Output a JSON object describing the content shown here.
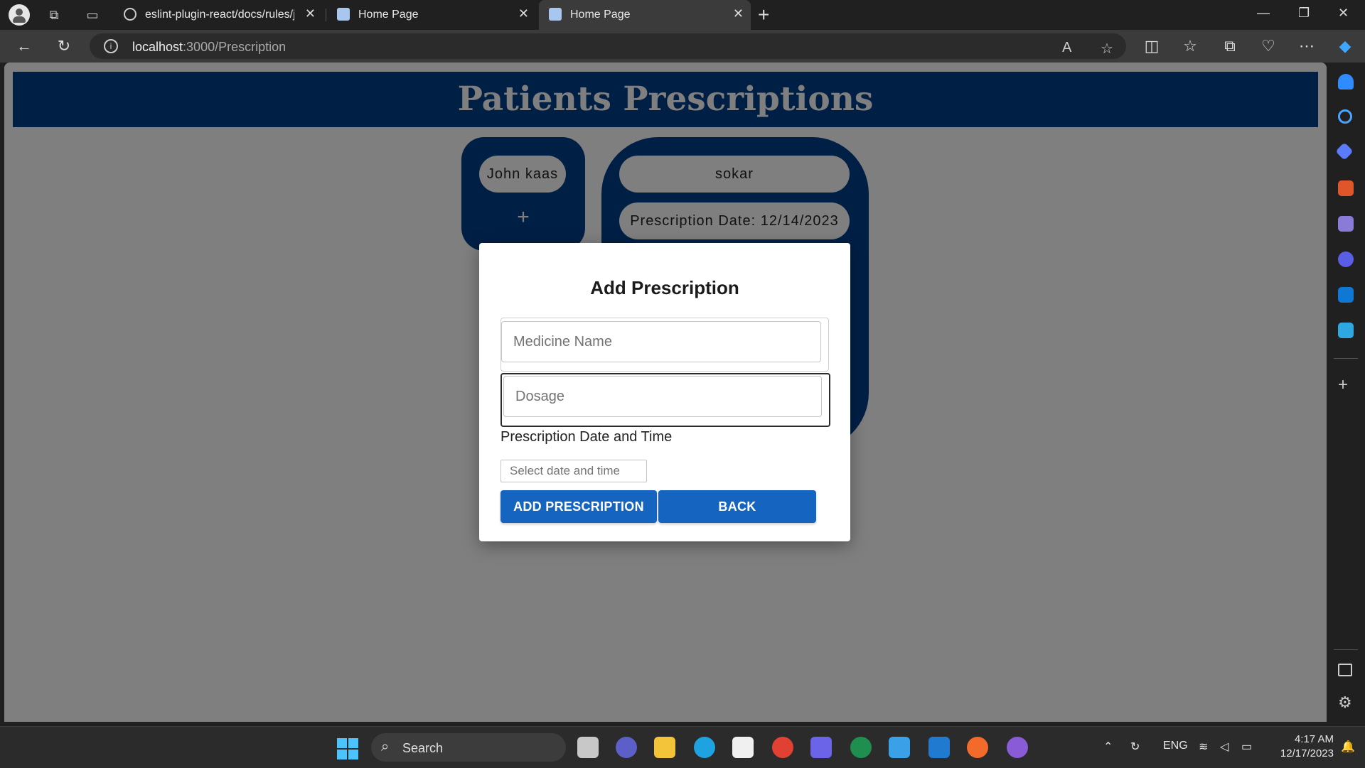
{
  "browser": {
    "tabs": [
      {
        "title": "eslint-plugin-react/docs/rules/jsx",
        "close": "✕"
      },
      {
        "title": "Home Page",
        "close": "✕"
      },
      {
        "title": "Home Page",
        "close": "✕"
      }
    ],
    "url_host": "localhost",
    "url_path": ":3000/Prescription"
  },
  "page": {
    "header_title": "Patients Prescriptions",
    "patient_name": "John kaas",
    "add_symbol": "+",
    "prescription_medicine": "sokar",
    "prescription_date": "Prescription Date: 12/14/2023"
  },
  "modal": {
    "title": "Add Prescription",
    "medicine_placeholder": "Medicine Name",
    "dosage_placeholder": "Dosage",
    "datetime_label": "Prescription Date and Time",
    "datetime_placeholder": "Select date and time",
    "add_button": "ADD PRESCRIPTION",
    "back_button": "BACK"
  },
  "taskbar": {
    "search_label": "Search",
    "language": "ENG",
    "time": "4:17 AM",
    "date": "12/17/2023"
  },
  "colors": {
    "header_bg": "#003f8a",
    "button_bg": "#1565c0",
    "backdrop": "rgba(0,0,0,0.5)"
  }
}
